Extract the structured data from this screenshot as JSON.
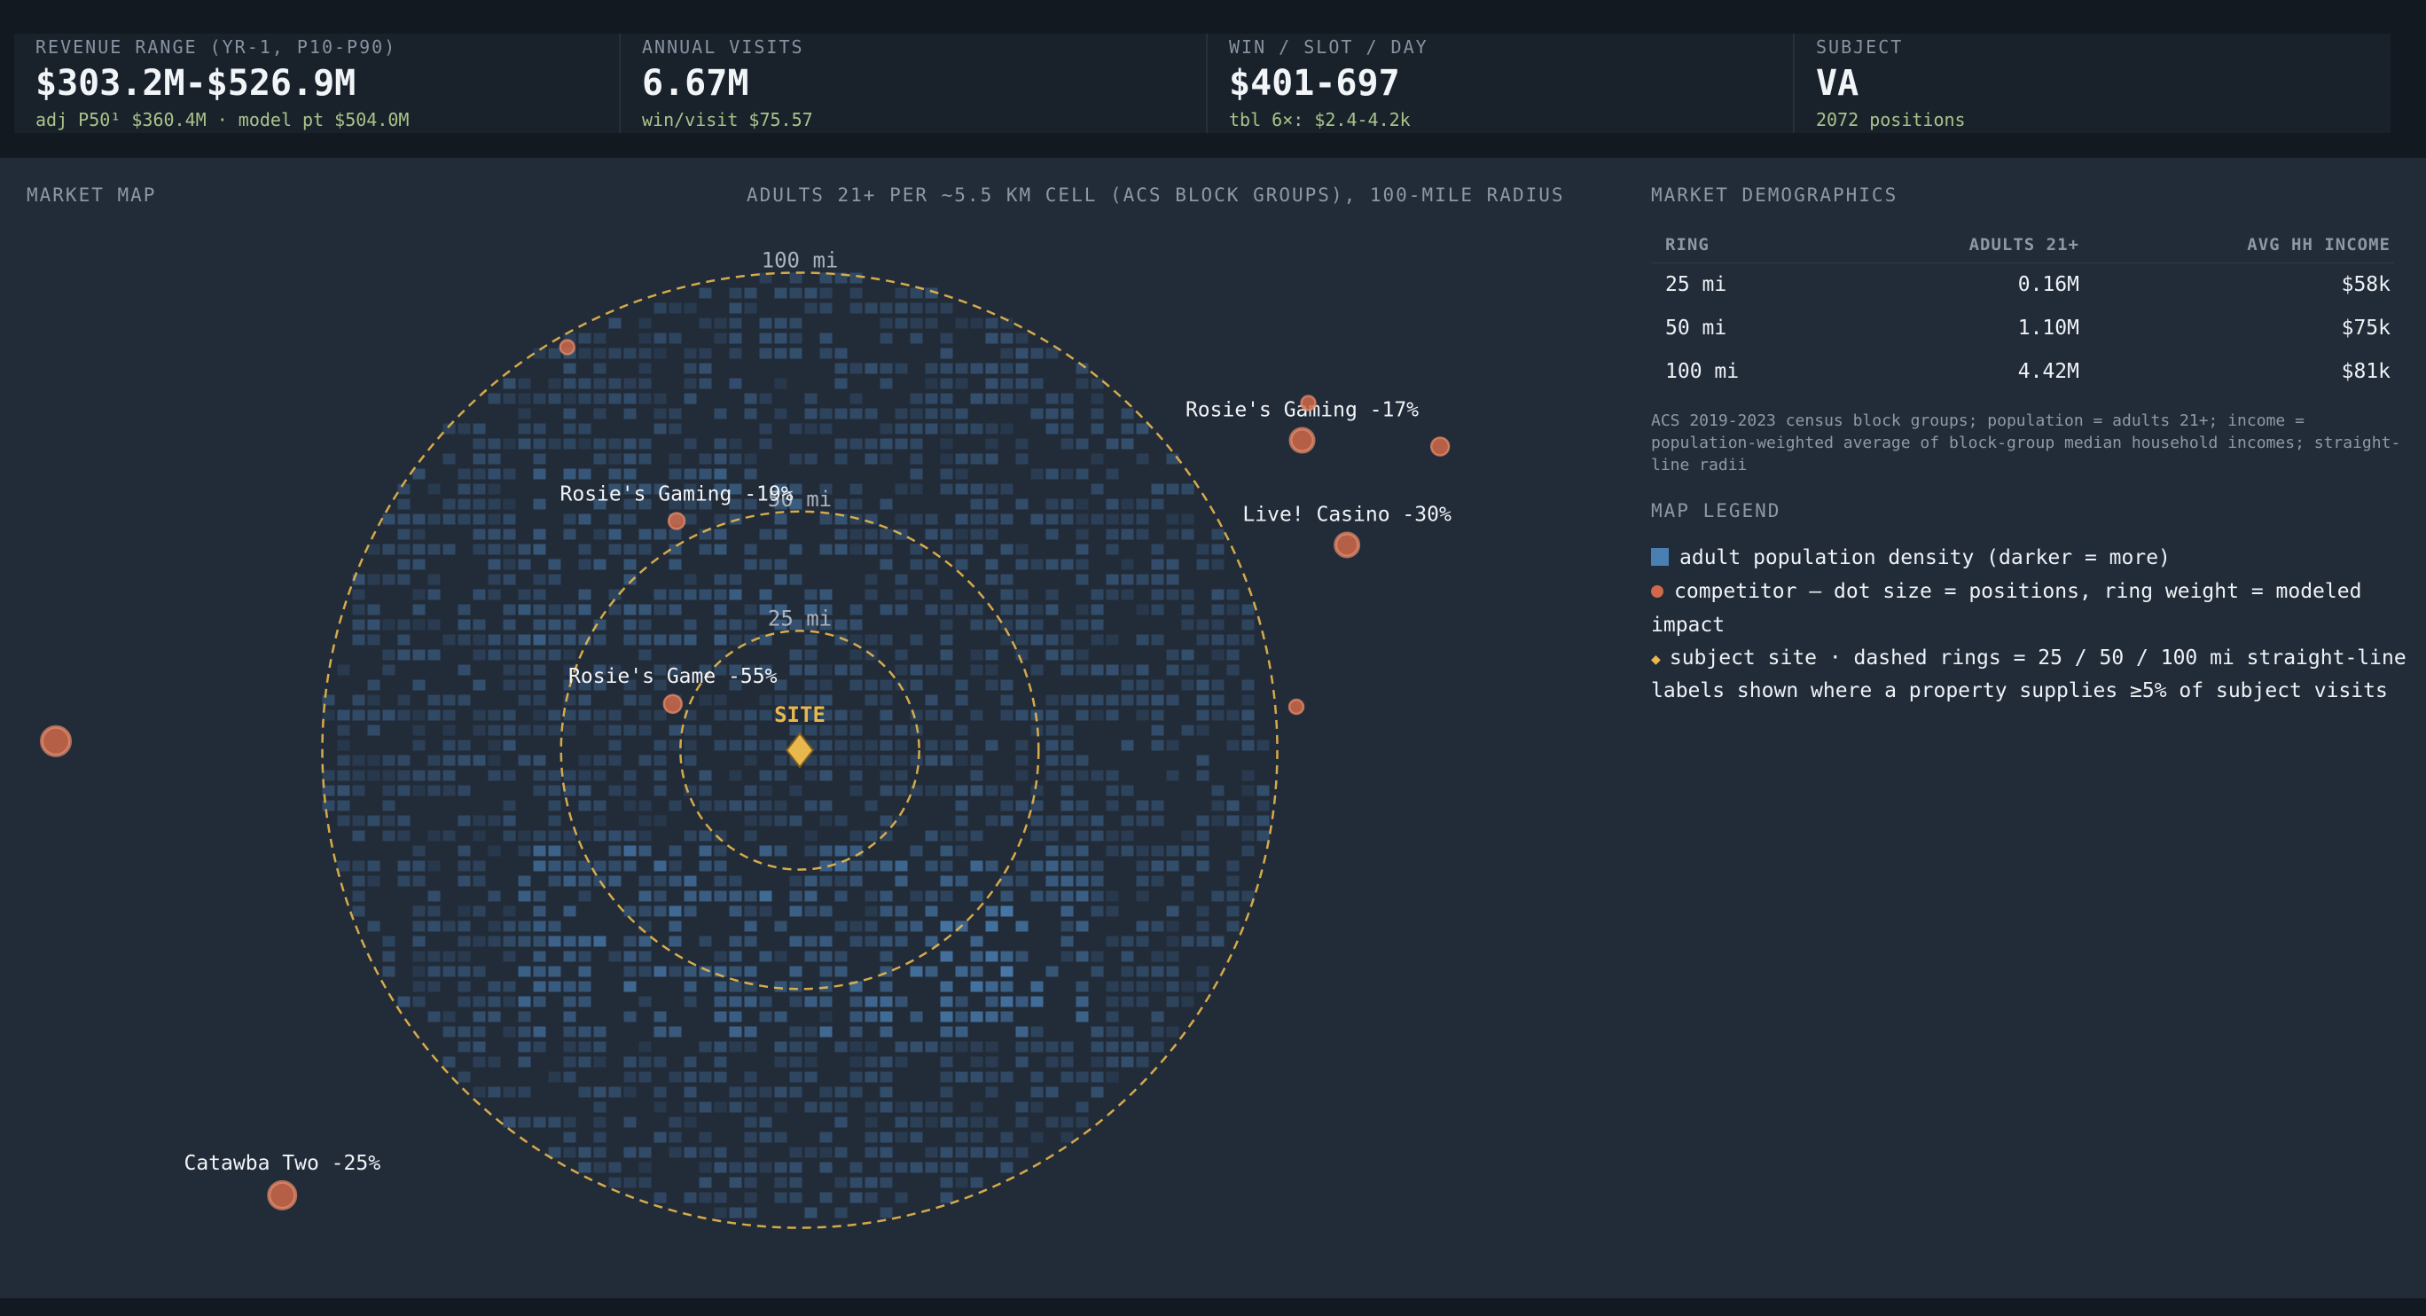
{
  "kpis": [
    {
      "label": "REVENUE RANGE (YR-1, P10-P90)",
      "value": "$303.2M-$526.9M",
      "sub": "adj P50¹ $360.4M · model pt $504.0M"
    },
    {
      "label": "ANNUAL VISITS",
      "value": "6.67M",
      "sub": "win/visit $75.57"
    },
    {
      "label": "WIN / SLOT / DAY",
      "value": "$401-697",
      "sub": "tbl 6×: $2.4-4.2k"
    },
    {
      "label": "SUBJECT",
      "value": "VA",
      "sub": "2072 positions"
    }
  ],
  "map": {
    "title": "MARKET MAP",
    "caption": "ADULTS 21+ PER ~5.5 KM CELL (ACS BLOCK GROUPS), 100-MILE RADIUS",
    "site_label": "SITE",
    "rings": [
      {
        "miles": 25,
        "label": "25 mi"
      },
      {
        "miles": 50,
        "label": "50 mi"
      },
      {
        "miles": 100,
        "label": "100 mi"
      }
    ],
    "competitors": [
      {
        "name": "Rosie's Gaming -19%",
        "dx_mi": -25.8,
        "dy_mi": -48.0,
        "size": 9,
        "labeled": true
      },
      {
        "name": "Rosie's Game -55%",
        "dx_mi": -26.6,
        "dy_mi": -9.7,
        "size": 10,
        "labeled": true
      },
      {
        "name": "Rosie's Gaming -17%",
        "dx_mi": 105.2,
        "dy_mi": -64.9,
        "size": 13,
        "labeled": true
      },
      {
        "name": "Live! Casino -30%",
        "dx_mi": 114.6,
        "dy_mi": -43.0,
        "size": 13,
        "labeled": true
      },
      {
        "name": "Catawba Two -25%",
        "dx_mi": -108.4,
        "dy_mi": 93.2,
        "size": 15,
        "labeled": true
      },
      {
        "name": "",
        "dx_mi": -48.7,
        "dy_mi": -84.4,
        "size": 8,
        "labeled": false
      },
      {
        "name": "",
        "dx_mi": 106.5,
        "dy_mi": -72.7,
        "size": 8,
        "labeled": false
      },
      {
        "name": "",
        "dx_mi": 134.1,
        "dy_mi": -63.6,
        "size": 10,
        "labeled": false
      },
      {
        "name": "",
        "dx_mi": 104.0,
        "dy_mi": -9.1,
        "size": 8,
        "labeled": false
      },
      {
        "name": "",
        "dx_mi": -155.8,
        "dy_mi": -1.9,
        "size": 16,
        "labeled": false
      }
    ],
    "colors": {
      "ring": "#e8b84e",
      "site": "#e8b84e",
      "competitor": "#d0694a",
      "density": "#4a7fb3"
    }
  },
  "demographics": {
    "title": "MARKET DEMOGRAPHICS",
    "headers": [
      "RING",
      "ADULTS 21+",
      "AVG HH INCOME"
    ],
    "rows": [
      [
        "25 mi",
        "0.16M",
        "$58k"
      ],
      [
        "50 mi",
        "1.10M",
        "$75k"
      ],
      [
        "100 mi",
        "4.42M",
        "$81k"
      ]
    ],
    "footnote": "ACS 2019-2023 census block groups; population = adults 21+; income = population-weighted average of block-group median household incomes; straight-line radii"
  },
  "legend": {
    "title": "MAP LEGEND",
    "density": "adult population density (darker = more)",
    "competitor": "competitor — dot size = positions, ring weight = modeled impact",
    "subject": "subject site · dashed rings = 25 / 50 / 100 mi straight-line",
    "labels_note": "labels shown where a property supplies ≥5% of subject visits"
  }
}
